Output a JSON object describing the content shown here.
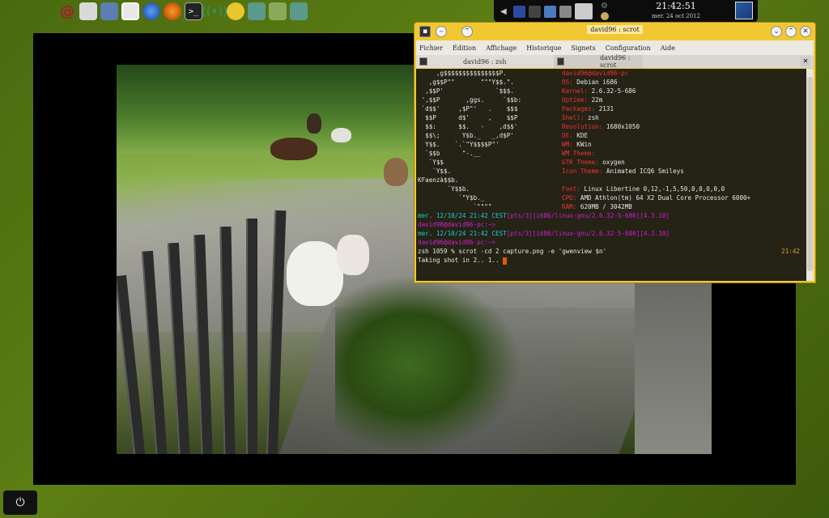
{
  "launcher": {
    "icons": [
      "debian-icon",
      "folder-icon",
      "system-icon",
      "chat-icon",
      "globe-icon",
      "rss-icon",
      "terminal-icon",
      "wifi-icon",
      "teapot-icon",
      "image-icon",
      "users-icon",
      "image-viewer-icon"
    ]
  },
  "clock": {
    "time": "21:42:51",
    "date": "mer. 24 oct 2012"
  },
  "window": {
    "title": "david96 : scrot",
    "menu": [
      "Fichier",
      "Édition",
      "Affichage",
      "Historique",
      "Signets",
      "Configuration",
      "Aide"
    ],
    "tabs": [
      "david96 : zsh",
      "david96 : scrot"
    ]
  },
  "terminal": {
    "ascii": [
      "     ,g$$$$$$$$$$$$$$$P.",
      "   ,g$$P\"\"       \"\"\"Y$$.\".",
      "  ,$$P'              `$$$.",
      " ',$$P       ,ggs.     `$$b:",
      " `d$$'     ,$P\"'   .    $$$",
      "  $$P      d$'     ,    $$P",
      "  $$:      $$.   -    ,d$$'",
      "  $$\\;      Y$b._   _,d$P'",
      "  Y$$.    `.`\"Y$$$$P\"'",
      "  `$$b      \"-.__",
      "   `Y$$",
      "    `Y$$.",
      "      `$$b.",
      "        `Y$$b.",
      "           `\"Y$b._",
      "               `\"\"\"\""
    ],
    "info": [
      {
        "label": "david96@david96-pc",
        "value": ""
      },
      {
        "label": "OS:",
        "value": "Debian i686"
      },
      {
        "label": "Kernel:",
        "value": "2.6.32-5-686"
      },
      {
        "label": "Uptime:",
        "value": "22m"
      },
      {
        "label": "Packages:",
        "value": "2131"
      },
      {
        "label": "Shell:",
        "value": "zsh"
      },
      {
        "label": "Resolution:",
        "value": "1680x1050"
      },
      {
        "label": "DE:",
        "value": "KDE"
      },
      {
        "label": "WM:",
        "value": "KWin"
      },
      {
        "label": "WM Theme:",
        "value": ""
      },
      {
        "label": "GTK Theme:",
        "value": "oxygen"
      },
      {
        "label": "Icon Theme:",
        "value": "Animated ICQ6 Smileys"
      },
      {
        "label": "Font:",
        "value": "Linux Libertine 0,12,-1,5,50,0,0,0,0,0"
      },
      {
        "label": "CPU:",
        "value": "AMD Athlon(tm) 64 X2 Dual Core Processor 6000+"
      },
      {
        "label": "RAM:",
        "value": "620MB / 3042MB"
      }
    ],
    "faenza": "KFaenza",
    "prompts": [
      {
        "date": "mer. 12/10/24 21:42 CEST",
        "pts": "[pts/3]",
        "path": "[i686/linux-gnu/2.6.32-5-686]",
        "ver": "[4.3.10]"
      },
      {
        "user": "david96@david96-pc:~>"
      },
      {
        "date": "mer. 12/10/24 21:42 CEST",
        "pts": "[pts/3]",
        "path": "[i686/linux-gnu/2.6.32-5-686]",
        "ver": "[4.3.10]"
      },
      {
        "user": "david96@david96-pc:~>"
      }
    ],
    "command": "zsh 1059 % scrot -cd 2 capture.png -e 'gwenview $n'",
    "command_time": "21:42",
    "output": "Taking shot in 2.. 1.. "
  },
  "power_label": "⏻"
}
